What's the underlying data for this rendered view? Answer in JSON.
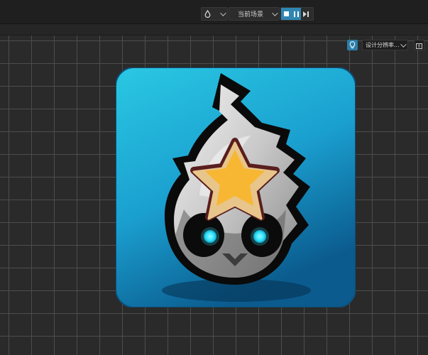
{
  "toolbar": {
    "drop_icon": "droplet-icon",
    "scene_select_value": "当前场景",
    "play_controls": [
      "stop-icon",
      "pause-icon",
      "step-icon"
    ]
  },
  "scene_view": {
    "light_icon": "lightbulb-icon",
    "resolution_value": "设计分辨率...",
    "resolution_icon": "resolution-icon"
  },
  "colors": {
    "accent": "#2f86b3",
    "grid": "#4d4d4d",
    "background": "#2a2a2a",
    "logo_bg_top": "#2ac8e3",
    "logo_bg_bottom": "#0b5b8e",
    "star": "#f7b733",
    "star_outline": "#5a1e1e",
    "eyes": "#33e6ff"
  }
}
